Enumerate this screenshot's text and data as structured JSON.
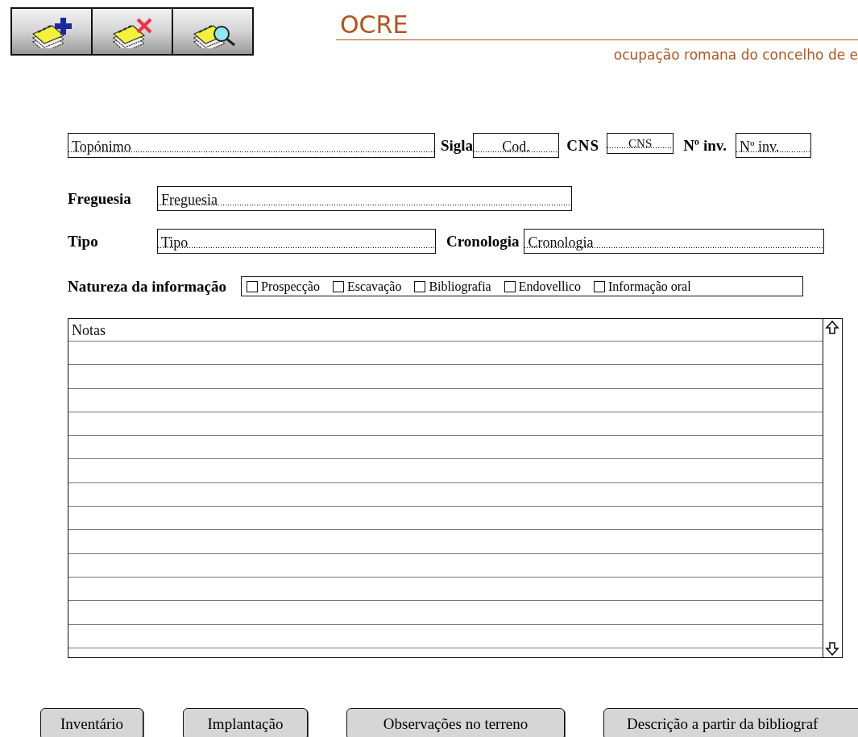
{
  "toolbar": [
    {
      "kind": "add"
    },
    {
      "kind": "delete"
    },
    {
      "kind": "search"
    }
  ],
  "header": {
    "title": "OCRE",
    "subtitle": "ocupação romana do concelho de e"
  },
  "identification": {
    "toponimo": {
      "placeholder": "Topónimo"
    },
    "sigla": {
      "label": "Sigla",
      "placeholder": "Cod."
    },
    "cns": {
      "label": "CNS",
      "placeholder": "CNS"
    },
    "inventario": {
      "label": "Nº inv.",
      "placeholder": "Nº inv."
    }
  },
  "freguesia": {
    "label": "Freguesia",
    "placeholder": "Freguesia"
  },
  "tipo": {
    "label": "Tipo",
    "placeholder": "Tipo"
  },
  "cronologia": {
    "label": "Cronologia",
    "placeholder": "Cronologia"
  },
  "natureza": {
    "label": "Natureza da informação",
    "options": [
      {
        "label": "Prospecção",
        "checked": false
      },
      {
        "label": "Escavação",
        "checked": false
      },
      {
        "label": "Bibliografia",
        "checked": false
      },
      {
        "label": "Endovellico",
        "checked": false
      },
      {
        "label": "Informação oral",
        "checked": false
      }
    ]
  },
  "notas": {
    "placeholder": "Notas"
  },
  "buttons": [
    {
      "label": "Inventário"
    },
    {
      "label": "Implantação"
    },
    {
      "label": "Observações no terreno"
    },
    {
      "label": "Descrição a partir da bibliograf"
    }
  ]
}
